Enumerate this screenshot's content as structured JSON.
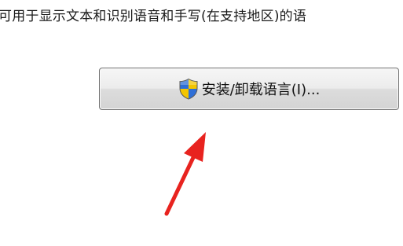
{
  "description": {
    "text": "可用于显示文本和识别语音和手写(在支持地区)的语"
  },
  "install_button": {
    "label": "安装/卸载语言(I)...",
    "icon": "uac-shield-icon"
  },
  "annotation": {
    "arrow_color": "#e8231f"
  },
  "colors": {
    "shield_blue": "#2f6fd6",
    "shield_yellow": "#f3c500"
  }
}
